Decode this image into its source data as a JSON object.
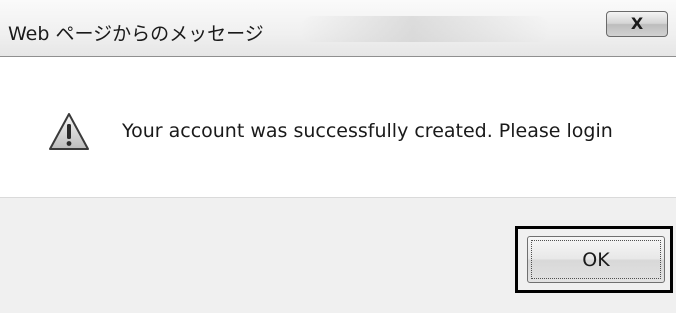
{
  "dialog": {
    "title": "Web ページからのメッセージ",
    "close_glyph": "X",
    "message": "Your account was successfully created. Please login",
    "icon": "warning-icon",
    "ok_label": "OK"
  },
  "colors": {
    "warning_fill": "#e8e8e8",
    "warning_stroke": "#404040",
    "focus_frame": "#000000"
  }
}
